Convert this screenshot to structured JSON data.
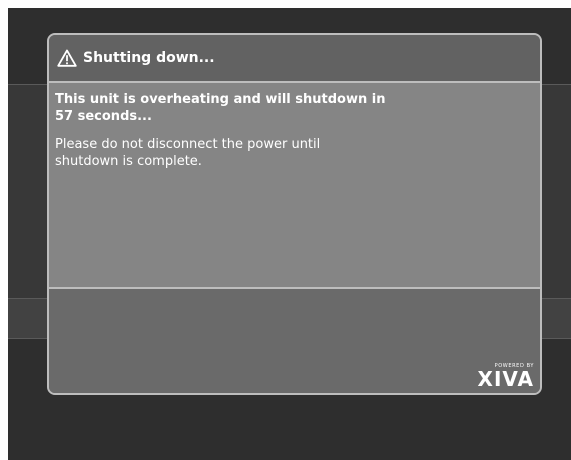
{
  "dialog": {
    "title": "Shutting down...",
    "title_icon": "warning-triangle-icon",
    "message_primary": "This unit is overheating and will shutdown in 57 seconds...",
    "message_secondary": "Please do not disconnect the power until shutdown is complete."
  },
  "branding": {
    "powered_by": "POWERED BY",
    "logo_text": "XIVA"
  },
  "colors": {
    "screen_bg": "#2e2e2e",
    "dialog_border": "#bdbdbd",
    "header_bg": "#626262",
    "body_bg": "#858585",
    "text": "#ffffff"
  }
}
